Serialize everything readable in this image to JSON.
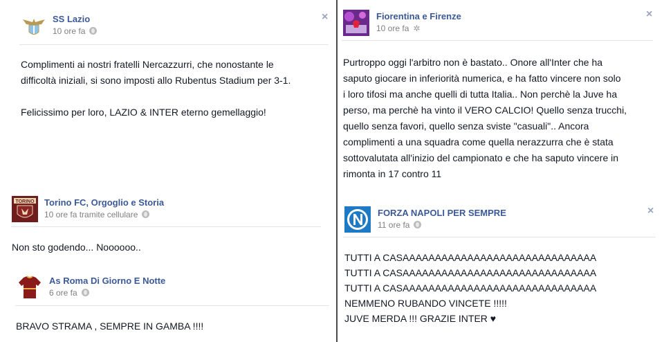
{
  "posts": [
    {
      "page_name": "SS Lazio",
      "time": "10 ore fa",
      "privacy_icon": "globe-icon",
      "lines": [
        "Complimenti ai nostri fratelli Nercazzurri, che nonostante le",
        "difficoltà iniziali, si sono imposti allo Rubentus Stadium per 3-1.",
        "",
        "Felicissimo per loro, LAZIO & INTER eterno gemellaggio!"
      ]
    },
    {
      "page_name": "Torino FC, Orgoglio e Storia",
      "time": "10 ore fa tramite cellulare",
      "privacy_icon": "globe-icon",
      "avatar_label": "TORINO",
      "lines": [
        "Non sto godendo... Noooooo.."
      ]
    },
    {
      "page_name": "As Roma Di Giorno E Notte",
      "time": "6 ore fa",
      "privacy_icon": "globe-icon",
      "lines": [
        "BRAVO STRAMA , SEMPRE IN GAMBA !!!!"
      ]
    },
    {
      "page_name": "Fiorentina e Firenze",
      "time": "10 ore fa",
      "privacy_icon": "gear-icon",
      "lines": [
        "Purtroppo oggi l'arbitro non è bastato.. Onore all'Inter che ha",
        "saputo giocare in inferiorità numerica, e ha fatto vincere non solo",
        "i loro tifosi ma anche quelli di tutta Italia.. Non perchè la Juve ha",
        "perso, ma perchè ha vinto il VERO CALCIO! Quello senza trucchi,",
        "quello senza favori, quello senza sviste \"casuali\".. Ancora",
        "complimenti a una squadra come quella nerazzurra che è stata",
        "sottovalutata all'inizio del campionato e che ha saputo vincere in",
        "rimonta in 17 contro 11"
      ]
    },
    {
      "page_name": "FORZA NAPOLI PER SEMPRE",
      "time": "11 ore fa",
      "privacy_icon": "globe-icon",
      "lines": [
        "TUTTI A CASAAAAAAAAAAAAAAAAAAAAAAAAAAAAAA",
        "TUTTI A CASAAAAAAAAAAAAAAAAAAAAAAAAAAAAAA",
        "TUTTI A CASAAAAAAAAAAAAAAAAAAAAAAAAAAAAAA",
        "NEMMENO RUBANDO VINCETE !!!!!",
        "JUVE MERDA !!! GRAZIE INTER ♥"
      ]
    }
  ],
  "close_glyph": "×",
  "colors": {
    "link": "#3b5998",
    "meta": "#7f7f7f",
    "close": "#9aa5bd",
    "separator": "#e1e2e3"
  }
}
